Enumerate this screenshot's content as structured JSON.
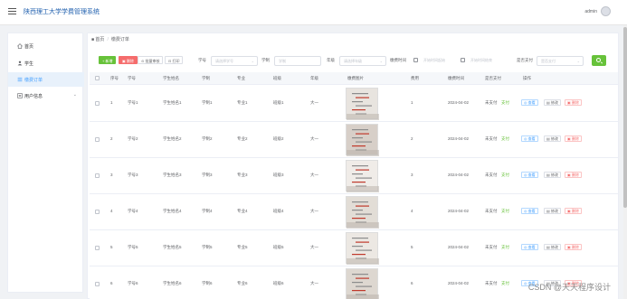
{
  "header": {
    "title": "陕西理工大学学费管理系统",
    "user": "admin"
  },
  "sidebar": {
    "items": [
      {
        "label": "首页",
        "icon": "home-icon"
      },
      {
        "label": "学生",
        "icon": "user-icon"
      },
      {
        "label": "缴费订单",
        "icon": "list-icon",
        "active": true
      },
      {
        "label": "用户信息",
        "icon": "document-icon",
        "expandable": true
      }
    ]
  },
  "breadcrumb": {
    "home": "首页",
    "current": "缴费订单"
  },
  "toolbar": {
    "add": "+ 新增",
    "delete": "删除",
    "bulk_review": "批量审核",
    "print": "打印",
    "filters": [
      {
        "label": "学号",
        "placeholder": "请选择学号",
        "type": "select"
      },
      {
        "label": "学制",
        "placeholder": "学制",
        "type": "input"
      },
      {
        "label": "年级",
        "placeholder": "请选择年级",
        "type": "select"
      },
      {
        "label": "缴费时间",
        "placeholder": "开始时间起始",
        "type": "date"
      },
      {
        "label": "",
        "placeholder": "开始时间结束",
        "type": "date"
      },
      {
        "label": "是否支付",
        "placeholder": "是否支付",
        "type": "select"
      }
    ]
  },
  "table": {
    "columns": [
      "序号",
      "学号",
      "学生姓名",
      "学制",
      "专业",
      "班级",
      "年级",
      "缴费图片",
      "费用",
      "缴费时间",
      "是否支付",
      "操作"
    ],
    "rows": [
      {
        "index": "1",
        "student_id": "学号1",
        "name": "学生姓名1",
        "system": "学制1",
        "major": "专业1",
        "class": "班级1",
        "grade": "大一",
        "fee": "1",
        "time": "2024-04-02",
        "paid": "未支付",
        "pay_action": "支付"
      },
      {
        "index": "2",
        "student_id": "学号2",
        "name": "学生姓名2",
        "system": "学制2",
        "major": "专业2",
        "class": "班级2",
        "grade": "大一",
        "fee": "2",
        "time": "2024-04-02",
        "paid": "未支付",
        "pay_action": "支付"
      },
      {
        "index": "3",
        "student_id": "学号3",
        "name": "学生姓名3",
        "system": "学制3",
        "major": "专业3",
        "class": "班级3",
        "grade": "大一",
        "fee": "3",
        "time": "2024-04-02",
        "paid": "未支付",
        "pay_action": "支付"
      },
      {
        "index": "4",
        "student_id": "学号4",
        "name": "学生姓名4",
        "system": "学制4",
        "major": "专业4",
        "class": "班级4",
        "grade": "大一",
        "fee": "4",
        "time": "2024-04-02",
        "paid": "未支付",
        "pay_action": "支付"
      },
      {
        "index": "5",
        "student_id": "学号5",
        "name": "学生姓名5",
        "system": "学制5",
        "major": "专业5",
        "class": "班级5",
        "grade": "大一",
        "fee": "5",
        "time": "2024-04-02",
        "paid": "未支付",
        "pay_action": "支付"
      },
      {
        "index": "6",
        "student_id": "学号6",
        "name": "学生姓名6",
        "system": "学制6",
        "major": "专业6",
        "class": "班级6",
        "grade": "大一",
        "fee": "6",
        "time": "2024-04-02",
        "paid": "未支付",
        "pay_action": "支付"
      }
    ],
    "actions": {
      "view": "查看",
      "edit": "修改",
      "delete": "删除"
    }
  },
  "watermark": "CSDN @天天程序设计",
  "colors": {
    "primary": "#409eff",
    "success": "#67c23a",
    "danger": "#f56c6c",
    "title": "#1f5fae"
  }
}
